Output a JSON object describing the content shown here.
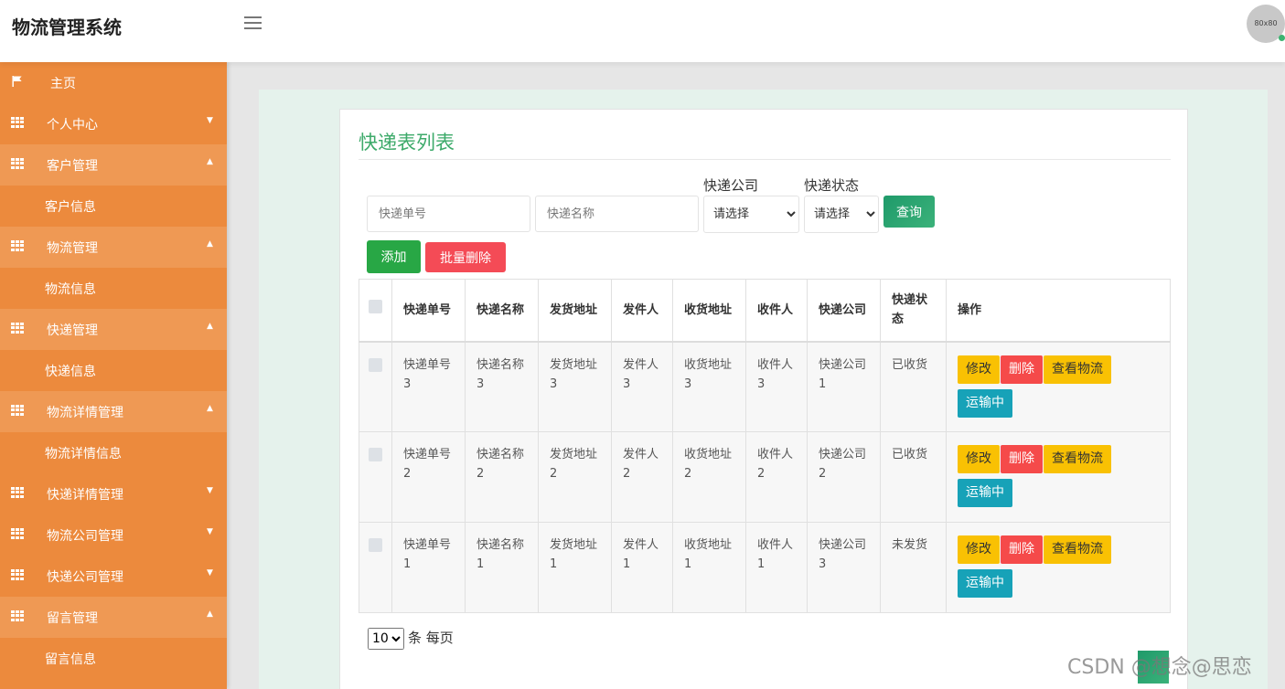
{
  "app": {
    "title": "物流管理系统",
    "avatar_text": "80x80"
  },
  "sidebar": {
    "items": [
      {
        "label": "主页",
        "icon": "flag-icon",
        "type": "home",
        "caret": ""
      },
      {
        "label": "个人中心",
        "icon": "grid-icon",
        "type": "group",
        "caret": "▼"
      },
      {
        "label": "客户管理",
        "icon": "grid-icon",
        "type": "group-open",
        "caret": "▲"
      },
      {
        "label": "客户信息",
        "icon": "",
        "type": "sub",
        "caret": ""
      },
      {
        "label": "物流管理",
        "icon": "grid-icon",
        "type": "group-open",
        "caret": "▲"
      },
      {
        "label": "物流信息",
        "icon": "",
        "type": "sub",
        "caret": ""
      },
      {
        "label": "快递管理",
        "icon": "grid-icon",
        "type": "group-open",
        "caret": "▲"
      },
      {
        "label": "快递信息",
        "icon": "",
        "type": "sub",
        "caret": ""
      },
      {
        "label": "物流详情管理",
        "icon": "grid-icon",
        "type": "group-open",
        "caret": "▲"
      },
      {
        "label": "物流详情信息",
        "icon": "",
        "type": "sub",
        "caret": ""
      },
      {
        "label": "快递详情管理",
        "icon": "grid-icon",
        "type": "group",
        "caret": "▼"
      },
      {
        "label": "物流公司管理",
        "icon": "grid-icon",
        "type": "group",
        "caret": "▼"
      },
      {
        "label": "快递公司管理",
        "icon": "grid-icon",
        "type": "group",
        "caret": "▼"
      },
      {
        "label": "留言管理",
        "icon": "grid-icon",
        "type": "group-open",
        "caret": "▲"
      },
      {
        "label": "留言信息",
        "icon": "",
        "type": "sub",
        "caret": ""
      }
    ]
  },
  "main": {
    "title": "快递表列表",
    "search": {
      "tracking_placeholder": "快递单号",
      "name_placeholder": "快递名称",
      "company_label": "快递公司",
      "company_selected": "请选择",
      "status_label": "快递状态",
      "status_selected": "请选择",
      "query_button": "查询"
    },
    "actions": {
      "add": "添加",
      "batch_delete": "批量删除"
    },
    "table": {
      "headers": [
        "快递单号",
        "快递名称",
        "发货地址",
        "发件人",
        "收货地址",
        "收件人",
        "快递公司",
        "快递状态",
        "操作"
      ],
      "rows": [
        [
          "快递单号3",
          "快递名称3",
          "发货地址3",
          "发件人3",
          "收货地址3",
          "收件人3",
          "快递公司1",
          "已收货"
        ],
        [
          "快递单号2",
          "快递名称2",
          "发货地址2",
          "发件人2",
          "收货地址2",
          "收件人2",
          "快递公司2",
          "已收货"
        ],
        [
          "快递单号1",
          "快递名称1",
          "发货地址1",
          "发件人1",
          "收货地址1",
          "收件人1",
          "快递公司3",
          "未发货"
        ]
      ],
      "row_actions": {
        "edit": "修改",
        "delete": "删除",
        "view_logistics": "查看物流",
        "in_transit": "运输中"
      }
    },
    "pagination": {
      "page_size": "10",
      "suffix": "条 每页"
    }
  },
  "watermark": "CSDN @想念@思恋",
  "colors": {
    "sidebar": "#ec8a3d",
    "accent": "#3daa6a",
    "edit": "#f9c103",
    "delete": "#f54a4a",
    "transit": "#17a2b8"
  }
}
